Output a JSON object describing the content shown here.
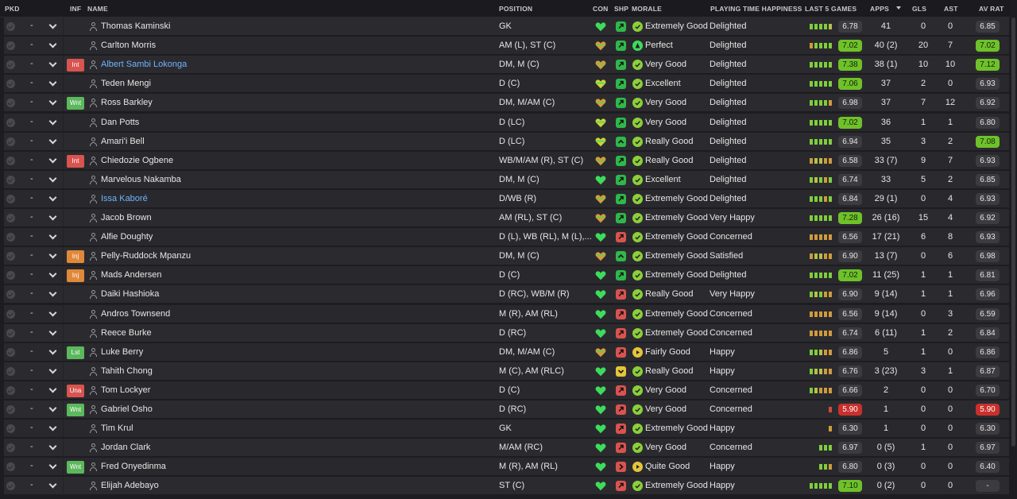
{
  "headers": {
    "pkd": "PKD",
    "inf": "INF",
    "name": "NAME",
    "position": "POSITION",
    "con": "CON",
    "shp": "SHP",
    "morale": "MORALE",
    "pth": "PLAYING TIME HAPPINESS",
    "last5": "LAST 5 GAMES",
    "apps": "APPS",
    "gls": "GLS",
    "ast": "AST",
    "avrat": "AV RAT"
  },
  "colors": {
    "good": "#7fce3c",
    "bad": "#d34a3a",
    "link": "#6fb3ff",
    "highlight": "#6fc12a"
  },
  "players": [
    {
      "sel": "-",
      "inf": "",
      "inf_type": "",
      "link": false,
      "name": "Thomas Kaminski",
      "position": "GK",
      "con": "green",
      "shp": "g-up",
      "mor_ic": "check",
      "morale": "Extremely Good",
      "pth": "Delighted",
      "form": [
        "g",
        "g",
        "g",
        "g",
        "y"
      ],
      "last5": "6.78",
      "last5_hi": false,
      "apps": "41",
      "gls": "0",
      "ast": "0",
      "avrat": "6.85",
      "avrat_state": ""
    },
    {
      "sel": "-",
      "inf": "",
      "inf_type": "",
      "link": false,
      "name": "Carlton Morris",
      "position": "AM (L), ST (C)",
      "con": "orange",
      "shp": "g-up",
      "mor_ic": "perfect",
      "morale": "Perfect",
      "pth": "Delighted",
      "form": [
        "o",
        "g",
        "g",
        "g",
        "g"
      ],
      "last5": "7.02",
      "last5_hi": true,
      "apps": "40 (2)",
      "gls": "20",
      "ast": "7",
      "avrat": "7.02",
      "avrat_state": "hi"
    },
    {
      "sel": "-",
      "inf": "Int",
      "inf_type": "red",
      "link": true,
      "name": "Albert Sambi Lokonga",
      "position": "DM, M (C)",
      "con": "orange",
      "shp": "g-up",
      "mor_ic": "check",
      "morale": "Very Good",
      "pth": "Delighted",
      "form": [
        "g",
        "g",
        "g",
        "g",
        "g"
      ],
      "last5": "7.38",
      "last5_hi": true,
      "apps": "38 (1)",
      "gls": "10",
      "ast": "10",
      "avrat": "7.12",
      "avrat_state": "hi"
    },
    {
      "sel": "-",
      "inf": "",
      "inf_type": "",
      "link": false,
      "name": "Teden Mengi",
      "position": "D (C)",
      "con": "yellow",
      "shp": "g-up",
      "mor_ic": "check",
      "morale": "Excellent",
      "pth": "Delighted",
      "form": [
        "g",
        "g",
        "g",
        "g",
        "g"
      ],
      "last5": "7.06",
      "last5_hi": true,
      "apps": "37",
      "gls": "2",
      "ast": "0",
      "avrat": "6.93",
      "avrat_state": ""
    },
    {
      "sel": "-",
      "inf": "Wnt",
      "inf_type": "green",
      "link": false,
      "name": "Ross Barkley",
      "position": "DM, M/AM (C)",
      "con": "orange",
      "shp": "g-up",
      "mor_ic": "check",
      "morale": "Very Good",
      "pth": "Delighted",
      "form": [
        "g",
        "g",
        "g",
        "g",
        "o"
      ],
      "last5": "6.98",
      "last5_hi": false,
      "apps": "37",
      "gls": "7",
      "ast": "12",
      "avrat": "6.92",
      "avrat_state": ""
    },
    {
      "sel": "-",
      "inf": "",
      "inf_type": "",
      "link": false,
      "name": "Dan Potts",
      "position": "D (LC)",
      "con": "yellow",
      "shp": "g-up",
      "mor_ic": "check",
      "morale": "Very Good",
      "pth": "Delighted",
      "form": [
        "g",
        "g",
        "g",
        "g",
        "g"
      ],
      "last5": "7.02",
      "last5_hi": true,
      "apps": "36",
      "gls": "1",
      "ast": "1",
      "avrat": "6.80",
      "avrat_state": ""
    },
    {
      "sel": "-",
      "inf": "",
      "inf_type": "",
      "link": false,
      "name": "Amari'i Bell",
      "position": "D (LC)",
      "con": "yellow",
      "shp": "g-chev",
      "mor_ic": "check",
      "morale": "Really Good",
      "pth": "Delighted",
      "form": [
        "g",
        "g",
        "g",
        "g",
        "g"
      ],
      "last5": "6.94",
      "last5_hi": false,
      "apps": "35",
      "gls": "3",
      "ast": "2",
      "avrat": "7.08",
      "avrat_state": "hi"
    },
    {
      "sel": "-",
      "inf": "Int",
      "inf_type": "red",
      "link": false,
      "name": "Chiedozie Ogbene",
      "position": "WB/M/AM (R), ST (C)",
      "con": "orange",
      "shp": "g-up",
      "mor_ic": "check",
      "morale": "Really Good",
      "pth": "Delighted",
      "form": [
        "o",
        "y",
        "y",
        "o",
        "o"
      ],
      "last5": "6.58",
      "last5_hi": false,
      "apps": "33 (7)",
      "gls": "9",
      "ast": "7",
      "avrat": "6.93",
      "avrat_state": ""
    },
    {
      "sel": "-",
      "inf": "",
      "inf_type": "",
      "link": false,
      "name": "Marvelous Nakamba",
      "position": "DM, M (C)",
      "con": "green",
      "shp": "g-up",
      "mor_ic": "check",
      "morale": "Excellent",
      "pth": "Delighted",
      "form": [
        "g",
        "y",
        "g",
        "o",
        "g"
      ],
      "last5": "6.74",
      "last5_hi": false,
      "apps": "33",
      "gls": "5",
      "ast": "2",
      "avrat": "6.85",
      "avrat_state": ""
    },
    {
      "sel": "-",
      "inf": "",
      "inf_type": "",
      "link": true,
      "name": "Issa Kaboré",
      "position": "D/WB (R)",
      "con": "orange",
      "shp": "g-up",
      "mor_ic": "check",
      "morale": "Extremely Good",
      "pth": "Delighted",
      "form": [
        "g",
        "g",
        "g",
        "o",
        "g"
      ],
      "last5": "6.84",
      "last5_hi": false,
      "apps": "29 (1)",
      "gls": "0",
      "ast": "4",
      "avrat": "6.93",
      "avrat_state": ""
    },
    {
      "sel": "-",
      "inf": "",
      "inf_type": "",
      "link": false,
      "name": "Jacob Brown",
      "position": "AM (RL), ST (C)",
      "con": "orange",
      "shp": "g-up",
      "mor_ic": "check",
      "morale": "Extremely Good",
      "pth": "Very Happy",
      "form": [
        "g",
        "g",
        "g",
        "g",
        "g"
      ],
      "last5": "7.28",
      "last5_hi": true,
      "apps": "26 (16)",
      "gls": "15",
      "ast": "4",
      "avrat": "6.92",
      "avrat_state": ""
    },
    {
      "sel": "-",
      "inf": "",
      "inf_type": "",
      "link": false,
      "name": "Alfie Doughty",
      "position": "D (L), WB (RL), M (L),...",
      "con": "green",
      "shp": "r-up",
      "mor_ic": "check",
      "morale": "Extremely Good",
      "pth": "Concerned",
      "form": [
        "o",
        "o",
        "o",
        "o",
        "o"
      ],
      "last5": "6.56",
      "last5_hi": false,
      "apps": "17 (21)",
      "gls": "6",
      "ast": "8",
      "avrat": "6.93",
      "avrat_state": ""
    },
    {
      "sel": "-",
      "inf": "Inj",
      "inf_type": "orange",
      "link": false,
      "name": "Pelly-Ruddock Mpanzu",
      "position": "DM, M (C)",
      "con": "orange",
      "shp": "g-chev",
      "mor_ic": "check",
      "morale": "Extremely Good",
      "pth": "Satisfied",
      "form": [
        "o",
        "y",
        "y",
        "o",
        "o"
      ],
      "last5": "6.90",
      "last5_hi": false,
      "apps": "13 (7)",
      "gls": "0",
      "ast": "6",
      "avrat": "6.98",
      "avrat_state": ""
    },
    {
      "sel": "-",
      "inf": "Inj",
      "inf_type": "orange",
      "link": false,
      "name": "Mads Andersen",
      "position": "D (C)",
      "con": "green",
      "shp": "g-up",
      "mor_ic": "check",
      "morale": "Extremely Good",
      "pth": "Delighted",
      "form": [
        "g",
        "g",
        "g",
        "g",
        "g"
      ],
      "last5": "7.02",
      "last5_hi": true,
      "apps": "11 (25)",
      "gls": "1",
      "ast": "1",
      "avrat": "6.81",
      "avrat_state": ""
    },
    {
      "sel": "-",
      "inf": "",
      "inf_type": "",
      "link": false,
      "name": "Daiki Hashioka",
      "position": "D (RC), WB/M (R)",
      "con": "green",
      "shp": "r-up",
      "mor_ic": "check",
      "morale": "Really Good",
      "pth": "Very Happy",
      "form": [
        "g",
        "y",
        "g",
        "o",
        "o"
      ],
      "last5": "6.90",
      "last5_hi": false,
      "apps": "9 (14)",
      "gls": "1",
      "ast": "1",
      "avrat": "6.96",
      "avrat_state": ""
    },
    {
      "sel": "-",
      "inf": "",
      "inf_type": "",
      "link": false,
      "name": "Andros Townsend",
      "position": "M (R), AM (RL)",
      "con": "green",
      "shp": "r-up",
      "mor_ic": "check",
      "morale": "Extremely Good",
      "pth": "Concerned",
      "form": [
        "o",
        "o",
        "o",
        "o",
        "o"
      ],
      "last5": "6.56",
      "last5_hi": false,
      "apps": "9 (14)",
      "gls": "0",
      "ast": "3",
      "avrat": "6.59",
      "avrat_state": ""
    },
    {
      "sel": "-",
      "inf": "",
      "inf_type": "",
      "link": false,
      "name": "Reece Burke",
      "position": "D (RC)",
      "con": "green",
      "shp": "r-up",
      "mor_ic": "check",
      "morale": "Extremely Good",
      "pth": "Concerned",
      "form": [
        "o",
        "o",
        "o",
        "o",
        "o"
      ],
      "last5": "6.74",
      "last5_hi": false,
      "apps": "6 (11)",
      "gls": "1",
      "ast": "2",
      "avrat": "6.84",
      "avrat_state": ""
    },
    {
      "sel": "-",
      "inf": "Lst",
      "inf_type": "green",
      "link": false,
      "name": "Luke Berry",
      "position": "DM, M/AM (C)",
      "con": "orange",
      "shp": "r-up",
      "mor_ic": "play",
      "morale": "Fairly Good",
      "pth": "Happy",
      "form": [
        "g",
        "g",
        "y",
        "o",
        "o"
      ],
      "last5": "6.86",
      "last5_hi": false,
      "apps": "5",
      "gls": "1",
      "ast": "0",
      "avrat": "6.86",
      "avrat_state": ""
    },
    {
      "sel": "-",
      "inf": "",
      "inf_type": "",
      "link": false,
      "name": "Tahith Chong",
      "position": "M (C), AM (RLC)",
      "con": "green",
      "shp": "y-down",
      "mor_ic": "check",
      "morale": "Really Good",
      "pth": "Happy",
      "form": [
        "g",
        "y",
        "y",
        "o",
        "o"
      ],
      "last5": "6.76",
      "last5_hi": false,
      "apps": "3 (23)",
      "gls": "3",
      "ast": "1",
      "avrat": "6.87",
      "avrat_state": ""
    },
    {
      "sel": "-",
      "inf": "Una",
      "inf_type": "red",
      "link": false,
      "name": "Tom Lockyer",
      "position": "D (C)",
      "con": "green",
      "shp": "r-up",
      "mor_ic": "check",
      "morale": "Very Good",
      "pth": "Concerned",
      "form": [
        "g",
        "y",
        "o",
        "o",
        "o"
      ],
      "last5": "6.66",
      "last5_hi": false,
      "apps": "2",
      "gls": "0",
      "ast": "0",
      "avrat": "6.70",
      "avrat_state": ""
    },
    {
      "sel": "-",
      "inf": "Wnt",
      "inf_type": "green",
      "link": false,
      "name": "Gabriel Osho",
      "position": "D (RC)",
      "con": "green",
      "shp": "r-up",
      "mor_ic": "check",
      "morale": "Very Good",
      "pth": "Concerned",
      "form": [
        "r"
      ],
      "last5": "5.90",
      "last5_hi": false,
      "last5_bad": true,
      "apps": "1",
      "gls": "0",
      "ast": "0",
      "avrat": "5.90",
      "avrat_state": "bad"
    },
    {
      "sel": "-",
      "inf": "",
      "inf_type": "",
      "link": false,
      "name": "Tim Krul",
      "position": "GK",
      "con": "green",
      "shp": "r-up",
      "mor_ic": "check",
      "morale": "Extremely Good",
      "pth": "Happy",
      "form": [
        "o"
      ],
      "last5": "6.30",
      "last5_hi": false,
      "apps": "1",
      "gls": "0",
      "ast": "0",
      "avrat": "6.30",
      "avrat_state": ""
    },
    {
      "sel": "-",
      "inf": "",
      "inf_type": "",
      "link": false,
      "name": "Jordan Clark",
      "position": "M/AM (RC)",
      "con": "green",
      "shp": "r-up",
      "mor_ic": "check",
      "morale": "Very Good",
      "pth": "Concerned",
      "form": [
        "g",
        "g",
        "g"
      ],
      "last5": "6.97",
      "last5_hi": false,
      "apps": "0 (5)",
      "gls": "1",
      "ast": "0",
      "avrat": "6.97",
      "avrat_state": ""
    },
    {
      "sel": "-",
      "inf": "Wnt",
      "inf_type": "green",
      "link": false,
      "name": "Fred Onyedinma",
      "position": "M (R), AM (RL)",
      "con": "green",
      "shp": "r-right",
      "mor_ic": "play",
      "morale": "Quite Good",
      "pth": "Happy",
      "form": [
        "g",
        "g",
        "o"
      ],
      "last5": "6.80",
      "last5_hi": false,
      "apps": "0 (3)",
      "gls": "0",
      "ast": "0",
      "avrat": "6.40",
      "avrat_state": ""
    },
    {
      "sel": "-",
      "inf": "",
      "inf_type": "",
      "link": false,
      "name": "Elijah Adebayo",
      "position": "ST (C)",
      "con": "green",
      "shp": "r-up",
      "mor_ic": "check",
      "morale": "Extremely Good",
      "pth": "Happy",
      "form": [
        "g",
        "g",
        "g",
        "g",
        "g"
      ],
      "last5": "7.10",
      "last5_hi": true,
      "apps": "0 (2)",
      "gls": "0",
      "ast": "0",
      "avrat": "-",
      "avrat_state": ""
    }
  ]
}
